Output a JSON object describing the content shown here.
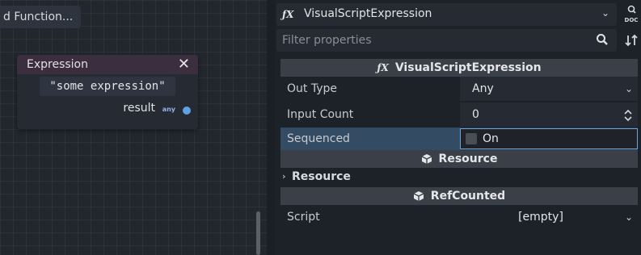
{
  "graph": {
    "add_function_label": "d Function...",
    "node": {
      "title": "Expression",
      "close_glyph": "✕",
      "expression_value": "\"some expression\"",
      "output_port_label": "result",
      "output_type_label": "any",
      "port_color": "#5fa1e3"
    }
  },
  "inspector": {
    "resource_picker": {
      "icon": "fx-icon",
      "value": "VisualScriptExpression",
      "chevron": "⌄"
    },
    "doc_icon": "doc-icon",
    "filter": {
      "placeholder": "Filter properties",
      "value": ""
    },
    "sections": {
      "main": {
        "icon": "fx-icon",
        "title": "VisualScriptExpression"
      },
      "resource": {
        "icon": "cube-icon",
        "title": "Resource"
      },
      "refcounted": {
        "icon": "cube-icon",
        "title": "RefCounted"
      }
    },
    "properties": {
      "out_type": {
        "label": "Out Type",
        "value": "Any",
        "arrow": "⌄"
      },
      "input_count": {
        "label": "Input Count",
        "value": "0",
        "arrow": "⌃⌄"
      },
      "sequenced": {
        "label": "Sequenced",
        "checked": false,
        "checkbox_label": "On"
      }
    },
    "category_resource": {
      "label": "Resource",
      "expanded": false
    },
    "script": {
      "label": "Script",
      "value": "[empty]",
      "arrow": "⌄"
    },
    "colors": {
      "selection": "#334b63",
      "focus_border": "#6aa4dd",
      "header_bg": "#3b4048"
    }
  }
}
